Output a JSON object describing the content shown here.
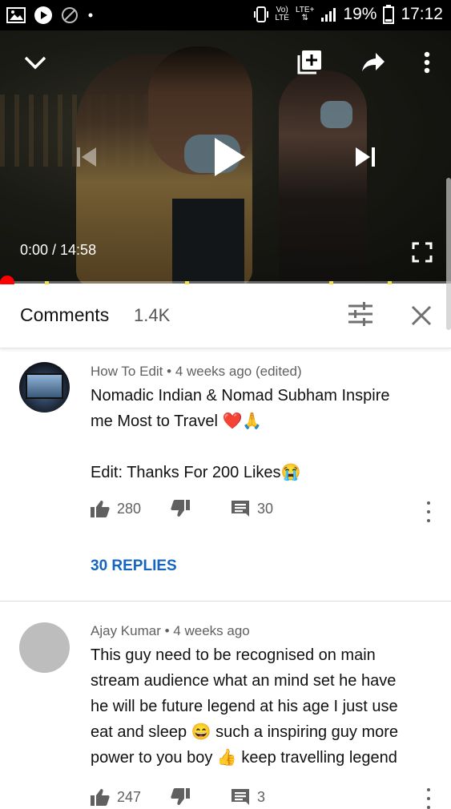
{
  "status_bar": {
    "volte": "Vo)",
    "lte_small": "LTE",
    "lte_plus": "LTE+",
    "battery": "19%",
    "time": "17:12"
  },
  "player": {
    "time_display": "0:00 / 14:58",
    "progress_fraction": 0,
    "chapter_markers": [
      0.1,
      0.41,
      0.73,
      0.86
    ]
  },
  "comments_header": {
    "title": "Comments",
    "count": "1.4K"
  },
  "comments": [
    {
      "author": "How To Edit",
      "age": "4 weeks ago (edited)",
      "lines": [
        "Nomadic Indian & Nomad Subham Inspire",
        "me Most to Travel ❤️🙏",
        "",
        "Edit: Thanks For 200 Likes😭"
      ],
      "likes": "280",
      "reply_count": "30",
      "replies_label": "30 REPLIES"
    },
    {
      "author": "Ajay Kumar",
      "age": "4 weeks ago",
      "lines": [
        "This guy need to be recognised on main",
        "stream audience what an mind set he have",
        "he will be future legend at his age I just use",
        "eat and sleep 😄 such a inspiring guy more",
        "power to you boy 👍 keep travelling legend"
      ],
      "likes": "247",
      "reply_count": "3"
    }
  ],
  "meta_separator": " • "
}
